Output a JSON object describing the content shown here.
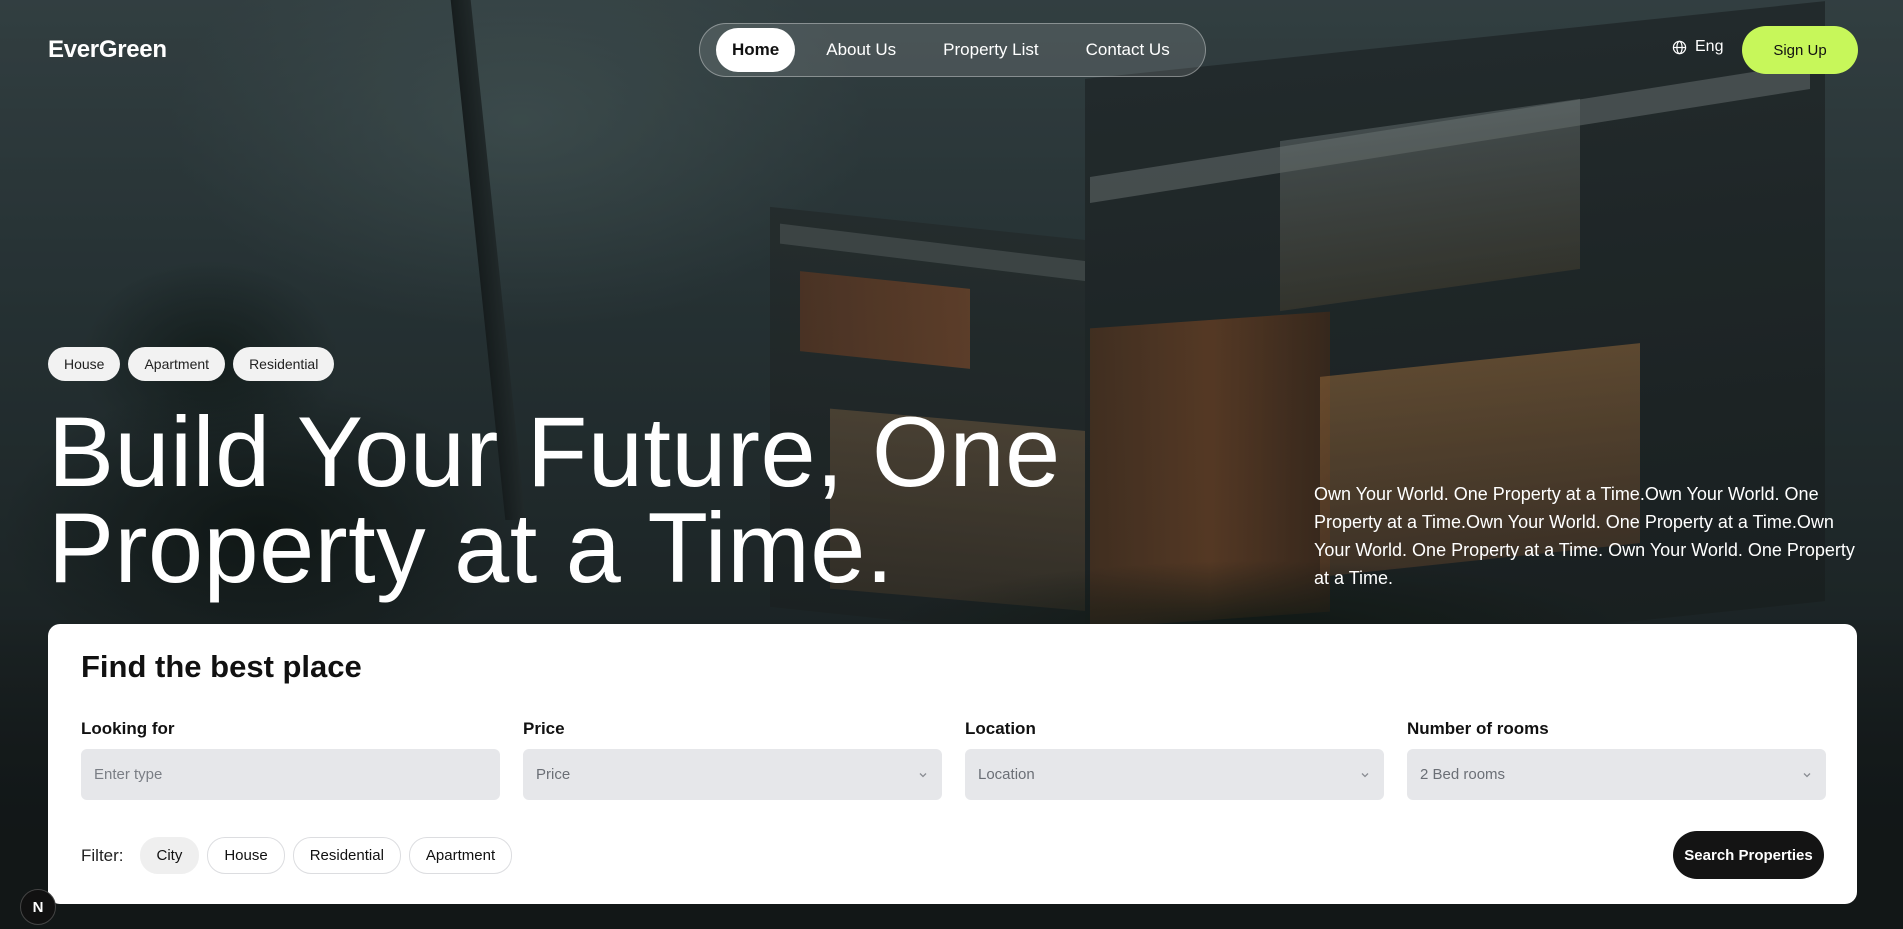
{
  "header": {
    "logo": "EverGreen",
    "nav": [
      {
        "label": "Home",
        "active": true
      },
      {
        "label": "About Us",
        "active": false
      },
      {
        "label": "Property List",
        "active": false
      },
      {
        "label": "Contact Us",
        "active": false
      }
    ],
    "language": "Eng",
    "signup_label": "Sign Up",
    "accent_color": "#c7f75a"
  },
  "hero": {
    "tags": [
      "House",
      "Apartment",
      "Residential"
    ],
    "headline_line1": "Build Your Future, One",
    "headline_line2": "Property at a Time.",
    "description": "Own Your World. One Property at a Time.Own Your World. One Property at a Time.Own Your World. One Property at a Time.Own Your World. One Property at a Time. Own Your World. One Property at a Time."
  },
  "search": {
    "title": "Find the best place",
    "fields": {
      "looking_for": {
        "label": "Looking for",
        "placeholder": "Enter type"
      },
      "price": {
        "label": "Price",
        "value": "Price"
      },
      "location": {
        "label": "Location",
        "value": "Location"
      },
      "rooms": {
        "label": "Number of rooms",
        "value": "2 Bed rooms"
      }
    },
    "filter_label": "Filter:",
    "filters": [
      {
        "label": "City",
        "active": true
      },
      {
        "label": "House",
        "active": false
      },
      {
        "label": "Residential",
        "active": false
      },
      {
        "label": "Apartment",
        "active": false
      }
    ],
    "submit_label": "Search Properties"
  },
  "dev_badge": "N"
}
